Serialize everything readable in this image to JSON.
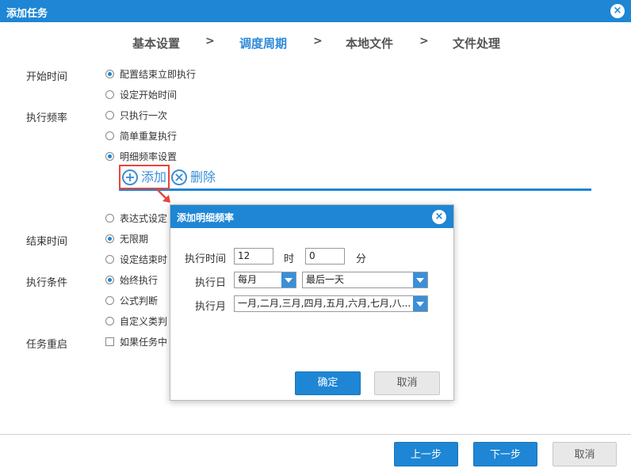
{
  "window": {
    "title": "添加任务",
    "close_icon": "×"
  },
  "steps": [
    {
      "label": "基本设置",
      "active": false
    },
    {
      "label": "调度周期",
      "active": true
    },
    {
      "label": "本地文件",
      "active": false
    },
    {
      "label": "文件处理",
      "active": false
    }
  ],
  "step_separator": ">",
  "form": {
    "start_time": {
      "label": "开始时间",
      "options": [
        "配置结束立即执行",
        "设定开始时间"
      ]
    },
    "frequency": {
      "label": "执行频率",
      "options": [
        "只执行一次",
        "简单重复执行",
        "明细频率设置",
        "表达式设定"
      ]
    },
    "toolbar": {
      "add_label": "添加",
      "delete_label": "删除",
      "add_icon": "+",
      "delete_icon": "×"
    },
    "end_time": {
      "label": "结束时间",
      "options": [
        "无限期",
        "设定结束时"
      ]
    },
    "condition": {
      "label": "执行条件",
      "options": [
        "始终执行",
        "公式判断",
        "自定义类判"
      ]
    },
    "restart": {
      "label": "任务重启",
      "checkbox_label": "如果任务中"
    }
  },
  "footer": {
    "prev_label": "上一步",
    "next_label": "下一步",
    "cancel_label": "取消"
  },
  "modal": {
    "title": "添加明细频率",
    "close_icon": "×",
    "time_label": "执行时间",
    "hour_value": "12",
    "hour_unit": "时",
    "minute_value": "0",
    "minute_unit": "分",
    "day_label": "执行日",
    "day_period": "每月",
    "day_value": "最后一天",
    "month_label": "执行月",
    "month_value": "一月,二月,三月,四月,五月,六月,七月,八...",
    "confirm_label": "确定",
    "cancel_label": "取消"
  },
  "colors": {
    "primary": "#1e86d4",
    "highlight": "#e8453c",
    "active_step": "#2d8ad8"
  }
}
